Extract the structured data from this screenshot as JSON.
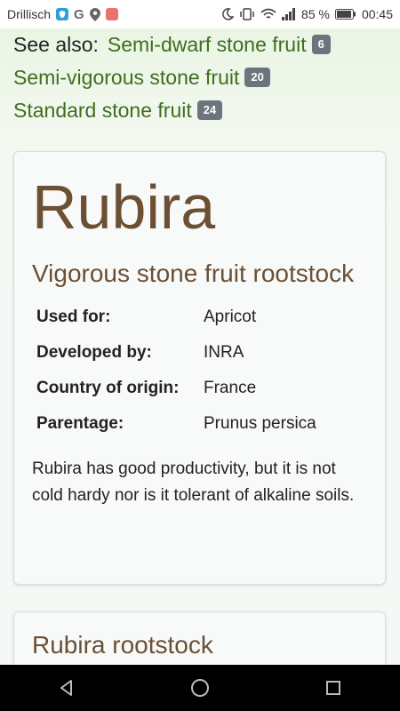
{
  "statusbar": {
    "carrier": "Drillisch",
    "battery_percent": "85 %",
    "time": "00:45",
    "g_icon": "G"
  },
  "see_also": {
    "label": "See also:",
    "links": [
      {
        "label": "Semi-dwarf stone fruit",
        "count": "6"
      },
      {
        "label": "Semi-vigorous stone fruit",
        "count": "20"
      },
      {
        "label": "Standard stone fruit",
        "count": "24"
      }
    ]
  },
  "card": {
    "title": "Rubira",
    "subtitle": "Vigorous stone fruit rootstock",
    "specs": [
      {
        "key": "Used for:",
        "value": "Apricot"
      },
      {
        "key": "Developed by:",
        "value": "INRA"
      },
      {
        "key": "Country of origin:",
        "value": "France"
      },
      {
        "key": "Parentage:",
        "value": "Prunus persica"
      }
    ],
    "description": "Rubira has good productivity, but it is not cold hardy nor is it tolerant of alkaline soils."
  },
  "card2": {
    "title": "Rubira rootstock"
  },
  "colors": {
    "heading": "#6b5034",
    "link": "#3f6e1e",
    "badge": "#6c757d"
  },
  "icons": [
    "shield-icon",
    "google-icon",
    "location-icon",
    "app-icon",
    "moon-icon",
    "vibrate-icon",
    "wifi-icon",
    "signal-icon",
    "battery-icon",
    "back-icon",
    "home-icon",
    "recents-icon"
  ]
}
